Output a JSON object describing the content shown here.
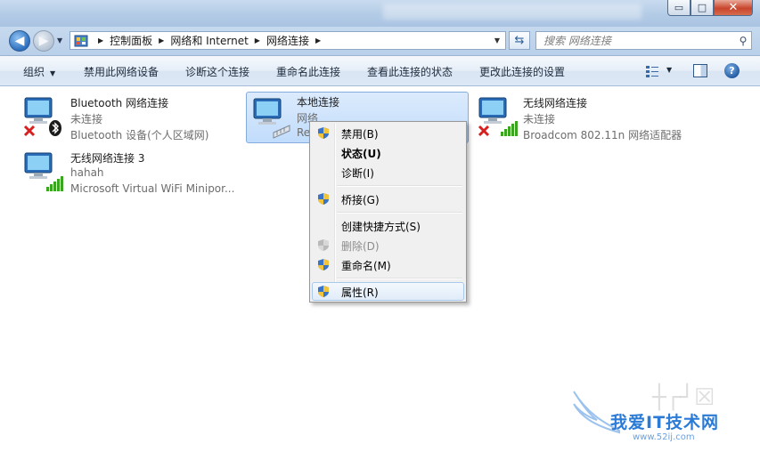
{
  "window": {
    "caption_buttons": {
      "minimize": "▭",
      "maximize": "□",
      "close": "✕"
    }
  },
  "address_bar": {
    "breadcrumbs": [
      "控制面板",
      "网络和 Internet",
      "网络连接"
    ],
    "search_placeholder": "搜索 网络连接"
  },
  "command_bar": {
    "organize": "组织",
    "items": [
      "禁用此网络设备",
      "诊断这个连接",
      "重命名此连接",
      "查看此连接的状态",
      "更改此连接的设置"
    ]
  },
  "connections": [
    {
      "name": "Bluetooth 网络连接",
      "status": "未连接",
      "device": "Bluetooth 设备(个人区域网)",
      "state": "disconnected",
      "icon": "bluetooth-network-icon"
    },
    {
      "name": "本地连接",
      "status": "网络",
      "device": "Re",
      "state": "connected",
      "icon": "lan-network-icon",
      "selected": true
    },
    {
      "name": "无线网络连接",
      "status": "未连接",
      "device": "Broadcom 802.11n 网络适配器",
      "state": "disconnected",
      "icon": "wireless-network-icon"
    },
    {
      "name": "无线网络连接 3",
      "status": "hahah",
      "device": "Microsoft Virtual WiFi Minipor...",
      "state": "connected",
      "icon": "wireless-network-icon"
    }
  ],
  "context_menu": {
    "items": [
      {
        "label": "禁用(B)",
        "shield": true
      },
      {
        "label": "状态(U)",
        "bold": true
      },
      {
        "label": "诊断(I)"
      },
      {
        "label": "桥接(G)",
        "shield": true
      },
      {
        "label": "创建快捷方式(S)"
      },
      {
        "label": "删除(D)",
        "shield": true,
        "disabled": true
      },
      {
        "label": "重命名(M)",
        "shield": true
      },
      {
        "label": "属性(R)",
        "shield": true,
        "hover": true
      }
    ]
  },
  "watermark": {
    "title": "我爱IT技术网",
    "url": "www.52ij.com"
  },
  "colors": {
    "selection": "#c1dcfc",
    "accent": "#2b7bd6",
    "disconnect_x": "#d62020",
    "signal": "#3aa51f"
  }
}
